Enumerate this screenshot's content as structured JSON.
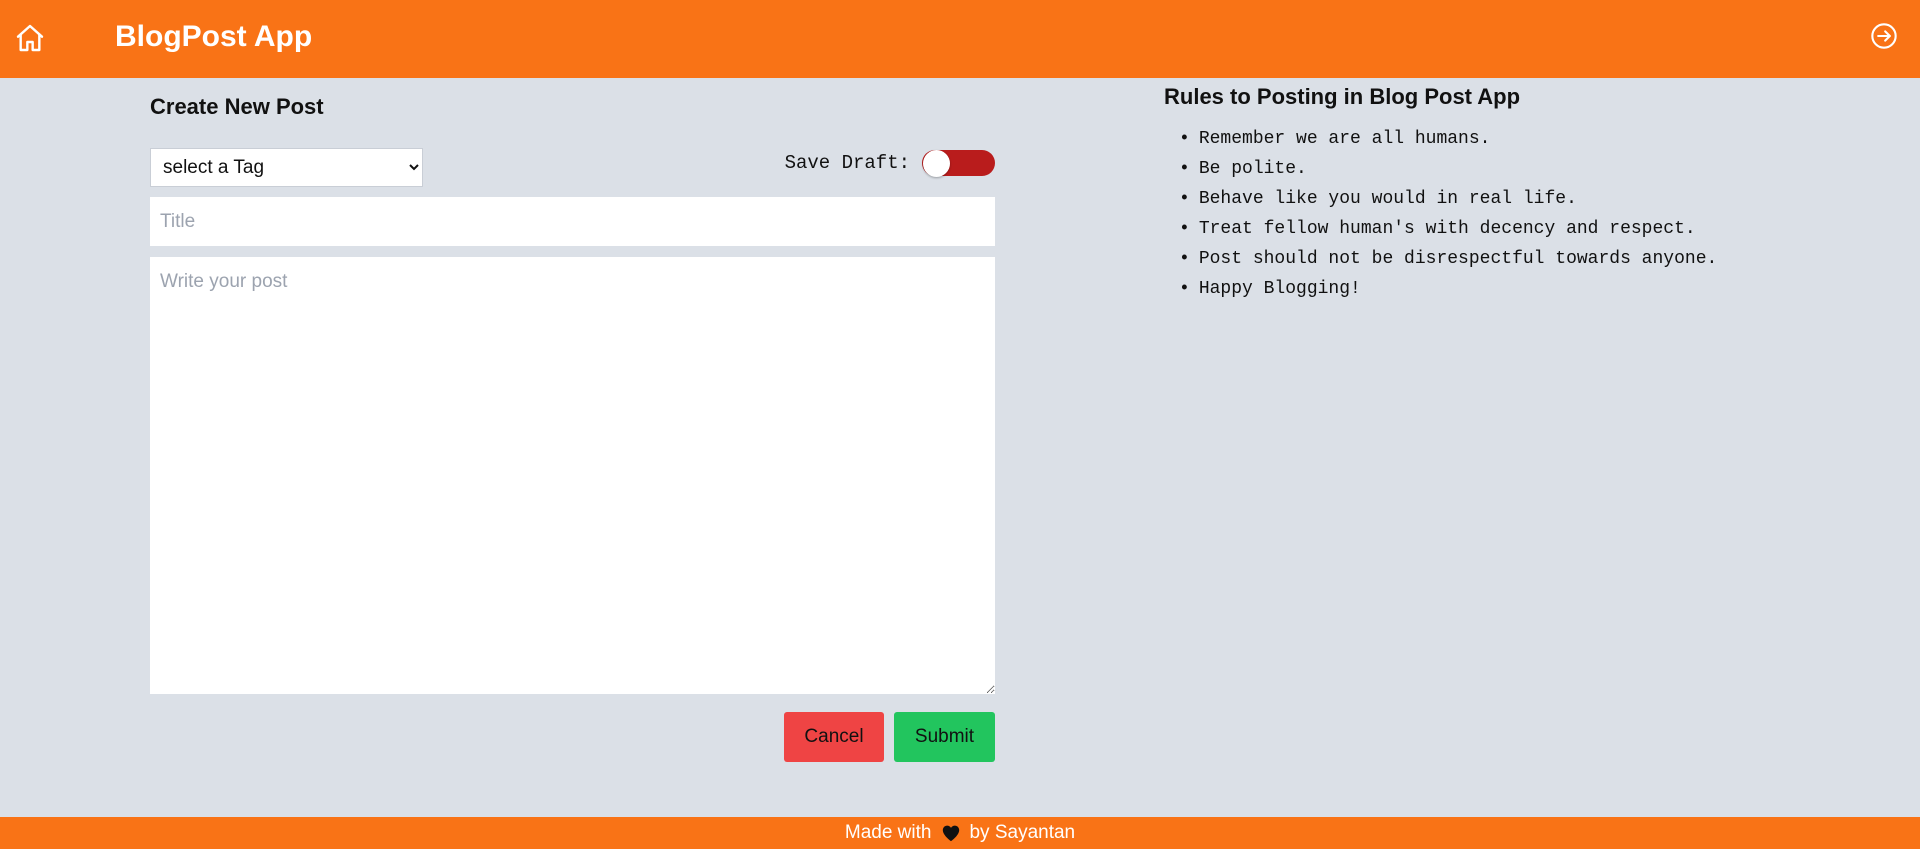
{
  "header": {
    "title": "BlogPost App",
    "home_icon": "home-icon",
    "logout_icon": "arrow-right-circle-icon",
    "background": "#f97316"
  },
  "form": {
    "heading": "Create New Post",
    "tag_select": {
      "selected": "select a Tag",
      "options": [
        "select a Tag"
      ]
    },
    "save_draft_label": "Save Draft:",
    "save_draft_on": false,
    "title_placeholder": "Title",
    "post_placeholder": "Write your post",
    "cancel_label": "Cancel",
    "submit_label": "Submit",
    "cancel_color": "#ef4444",
    "submit_color": "#22c55e",
    "toggle_color": "#b91c1c"
  },
  "rules": {
    "heading": "Rules to Posting in Blog Post App",
    "items": [
      "Remember we are all humans.",
      "Be polite.",
      "Behave like you would in real life.",
      "Treat fellow human's with decency and respect.",
      "Post should not be disrespectful towards anyone.",
      "Happy Blogging!"
    ]
  },
  "footer": {
    "made_with": "Made with",
    "heart_icon": "heart-icon",
    "by_author": "by Sayantan"
  }
}
